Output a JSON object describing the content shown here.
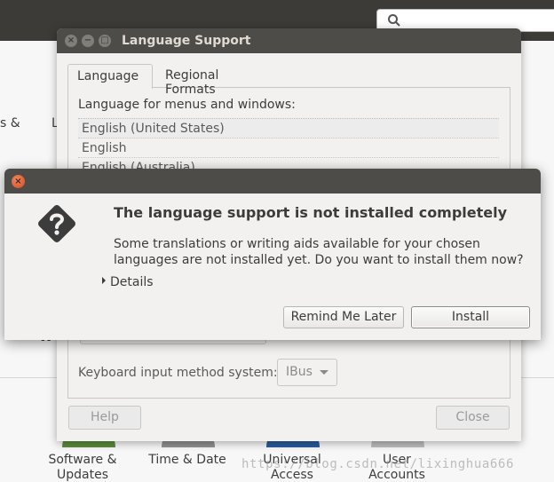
{
  "system_settings": {
    "fragments": [
      "s &",
      "L",
      "W"
    ],
    "items": [
      {
        "label": "Software &\nUpdates",
        "icon": "software-updates-icon"
      },
      {
        "label": "Time & Date",
        "icon": "clock-icon"
      },
      {
        "label": "Universal\nAccess",
        "icon": "universal-access-icon"
      },
      {
        "label": "User\nAccounts",
        "icon": "user-accounts-icon"
      }
    ]
  },
  "watermark": "https://blog.csdn.net/lixinghua666",
  "language_support": {
    "title": "Language Support",
    "tabs": [
      {
        "label": "Language",
        "active": true
      },
      {
        "label": "Regional Formats",
        "active": false
      }
    ],
    "list_caption": "Language for menus and windows:",
    "languages": [
      "English (United States)",
      "English",
      "English (Australia)"
    ],
    "keyboard_label": "Keyboard input method system:",
    "keyboard_value": "IBus",
    "help_label": "Help",
    "close_label": "Close"
  },
  "dialog": {
    "heading": "The language support is not installed completely",
    "body": "Some translations or writing aids available for your chosen languages are not installed yet. Do you want to install them now?",
    "details_label": "Details",
    "remind_label": "Remind Me Later",
    "install_label": "Install",
    "icon": "question-diamond-icon"
  },
  "colors": {
    "titlebar": "#4e4c48",
    "window_bg": "#f2f1f0",
    "close_button": "#e95420",
    "topbar": "#3c3b37"
  }
}
